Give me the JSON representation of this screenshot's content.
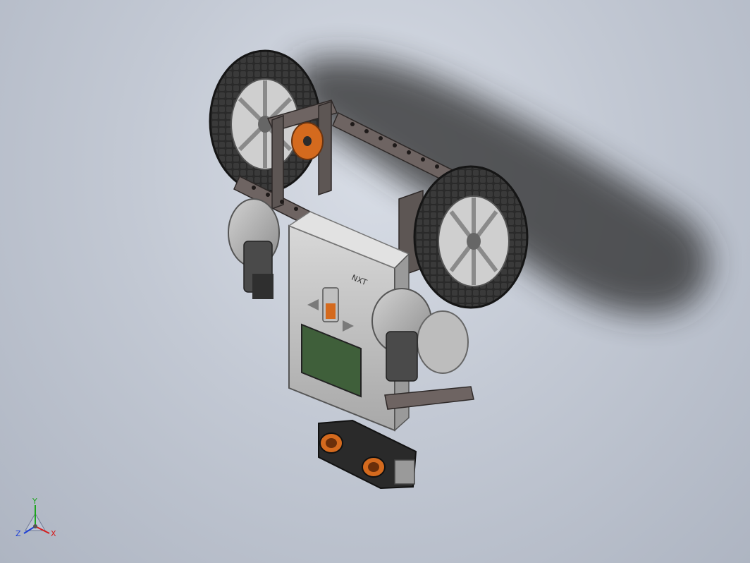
{
  "window": {
    "title": ""
  },
  "model": {
    "brick_label": "NXT"
  },
  "triad": {
    "x_label": "X",
    "y_label": "Y",
    "z_label": "Z",
    "x_color": "#d61c1c",
    "y_color": "#1ea51e",
    "z_color": "#1c3fd6"
  },
  "colors": {
    "background_top": "#d8dde6",
    "background_bottom": "#aeb5c2",
    "beam": "#6e6462",
    "tire": "#2b2b2b",
    "hub": "#c9c9c9",
    "motor": "#a9a9a9",
    "screen": "#3f5f3a",
    "accent_orange": "#d46a1e",
    "sensor": "#2a2a2a"
  },
  "icons": {
    "triad": "coordinate-triad-icon"
  }
}
